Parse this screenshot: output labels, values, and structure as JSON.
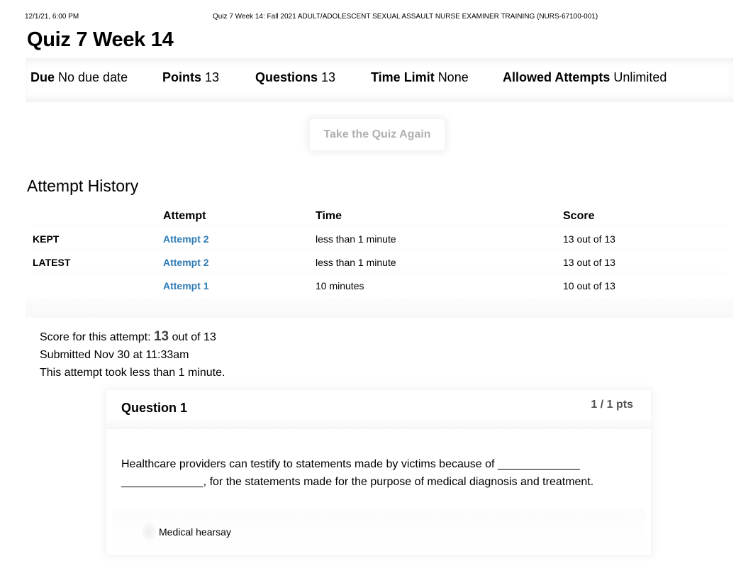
{
  "print_header": {
    "date": "12/1/21, 6:00 PM",
    "title": "Quiz 7 Week 14: Fall 2021 ADULT/ADOLESCENT SEXUAL ASSAULT NURSE EXAMINER TRAINING (NURS-67100-001)"
  },
  "quiz": {
    "title": "Quiz 7 Week 14",
    "details": [
      {
        "label": "Due",
        "value": "No due date"
      },
      {
        "label": "Points",
        "value": "13"
      },
      {
        "label": "Questions",
        "value": "13"
      },
      {
        "label": "Time Limit",
        "value": "None"
      },
      {
        "label": "Allowed Attempts",
        "value": "Unlimited"
      }
    ],
    "take_again_label": "Take the Quiz Again"
  },
  "attempt_history": {
    "heading": "Attempt History",
    "columns": [
      "",
      "Attempt",
      "Time",
      "Score"
    ],
    "rows": [
      {
        "tag": "KEPT",
        "attempt": "Attempt 2",
        "time": "less than 1 minute",
        "score": "13 out of 13"
      },
      {
        "tag": "LATEST",
        "attempt": "Attempt 2",
        "time": "less than 1 minute",
        "score": "13 out of 13"
      },
      {
        "tag": "",
        "attempt": "Attempt 1",
        "time": "10 minutes",
        "score": "10 out of 13"
      }
    ]
  },
  "attempt_summary": {
    "score_prefix": "Score for this attempt:",
    "score": "13",
    "score_suffix": "out of 13",
    "submitted": "Submitted Nov 30 at 11:33am",
    "duration": "This attempt took less than 1 minute."
  },
  "question": {
    "name": "Question 1",
    "points": "1 / 1 pts",
    "text": "Healthcare providers can testify to statements made by victims because of _____________ _____________, for the statements made for the purpose of medical diagnosis and treatment.",
    "answers": [
      {
        "label": "Medical hearsay"
      }
    ]
  }
}
